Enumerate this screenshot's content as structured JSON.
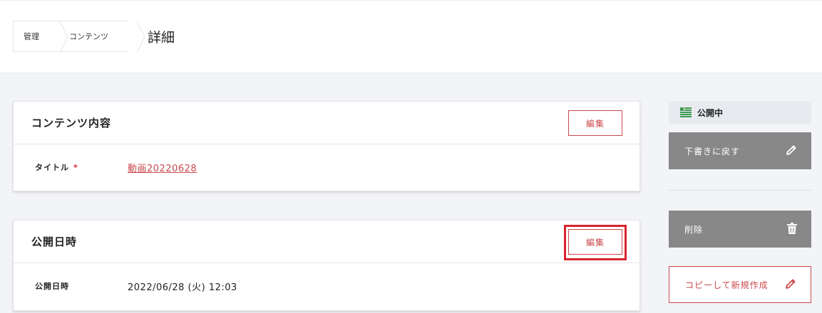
{
  "breadcrumb": {
    "items": [
      "管理",
      "コンテンツ"
    ],
    "current": "詳細"
  },
  "cards": [
    {
      "title": "コンテンツ内容",
      "edit_label": "編集",
      "rows": [
        {
          "label": "タイトル",
          "required_mark": "*",
          "value": "動画20220628"
        }
      ]
    },
    {
      "title": "公開日時",
      "edit_label": "編集",
      "rows": [
        {
          "label": "公開日時",
          "value": "2022/06/28 (火) 12:03"
        }
      ]
    }
  ],
  "sidebar": {
    "status": {
      "label": "公開中",
      "icon": "status-list-icon",
      "icon_color": "#3e9a4f"
    },
    "revert_draft_label": "下書きに戻す",
    "delete_label": "削除",
    "copy_new_label": "コピーして新規作成"
  },
  "colors": {
    "accent": "#c9484c",
    "highlight": "#d9232d",
    "grey_button": "#888888"
  }
}
